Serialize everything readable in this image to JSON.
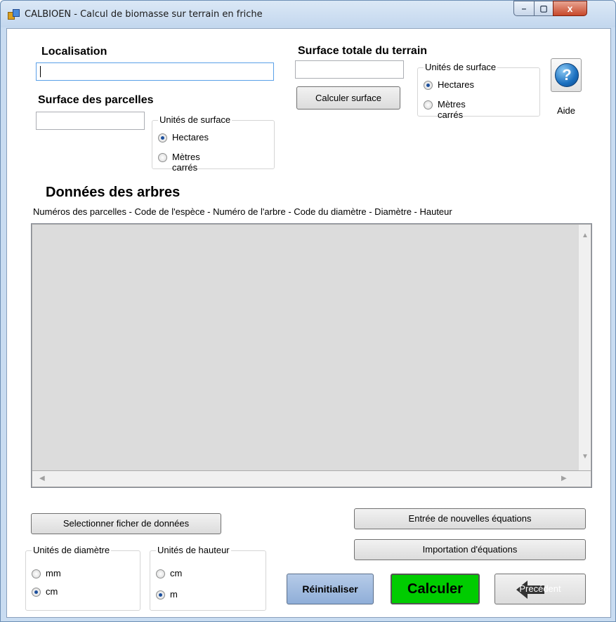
{
  "window": {
    "title": "CALBIOEN - Calcul de biomasse sur terrain en friche",
    "minimize": "–",
    "maximize": "▢",
    "close": "x"
  },
  "localisation": {
    "label": "Localisation",
    "value": ""
  },
  "surface_parcelles": {
    "label": "Surface des parcelles",
    "value": "",
    "units_group": "Unités de surface",
    "opt_hectares": "Hectares",
    "opt_m2": "Mètres carrés",
    "selected": "Hectares"
  },
  "surface_totale": {
    "label": "Surface totale du terrain",
    "value": "",
    "calc_button": "Calculer surface",
    "units_group": "Unités de surface",
    "opt_hectares": "Hectares",
    "opt_m2": "Mètres carrés",
    "selected": "Hectares"
  },
  "help": {
    "icon": "?",
    "label": "Aide"
  },
  "donnees": {
    "title": "Données des arbres",
    "columns_caption": "Numéros des parcelles - Code de l'espèce - Numéro de l'arbre - Code du diamètre - Diamètre - Hauteur"
  },
  "buttons": {
    "select_file": "Selectionner ficher de données",
    "new_equations": "Entrée de nouvelles équations",
    "import_equations": "Importation d'équations",
    "reset": "Réinitialiser",
    "calculate": "Calculer",
    "previous": "Precédent"
  },
  "diametre_units": {
    "label": "Unités de diamètre",
    "opt_mm": "mm",
    "opt_cm": "cm",
    "selected": "cm"
  },
  "hauteur_units": {
    "label": "Unités de hauteur",
    "opt_cm": "cm",
    "opt_m": "m",
    "selected": "m"
  },
  "colors": {
    "calculate_bg": "#00cc00",
    "reset_bg": "#9bb6dc",
    "help_blue": "#1a6fbf"
  }
}
